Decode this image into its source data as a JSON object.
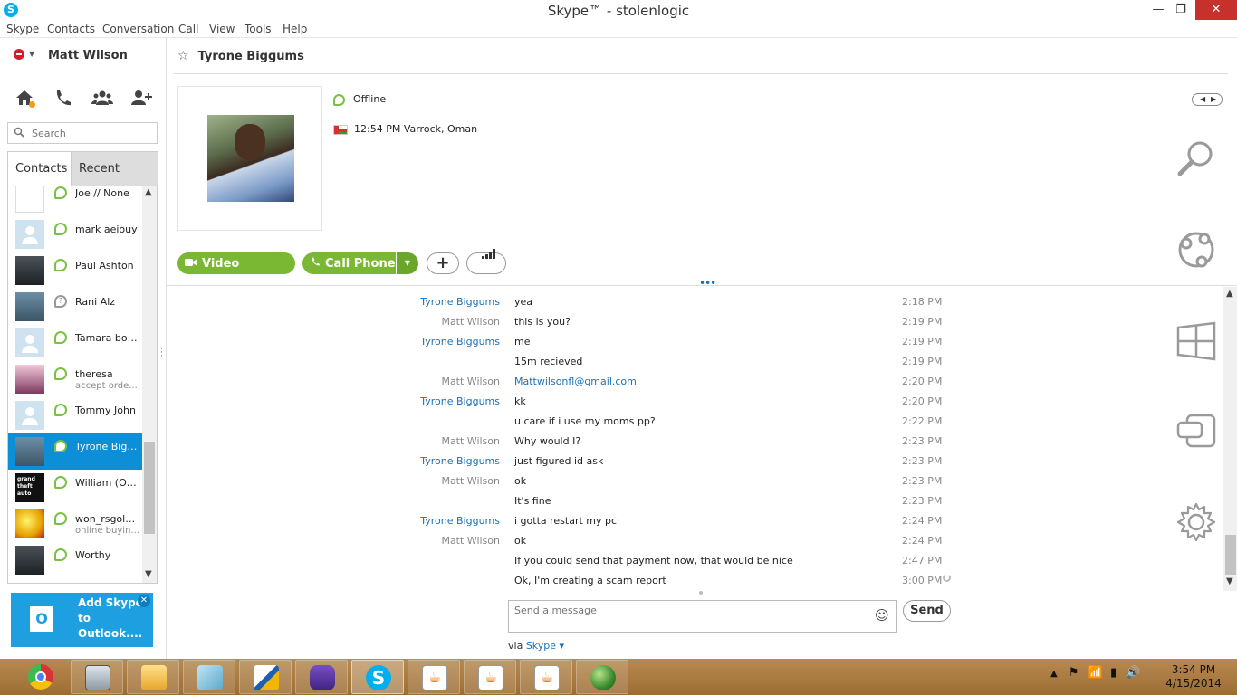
{
  "window": {
    "title": "Skype™ - stolenlogic",
    "minimize": "—",
    "restore": "❐",
    "close": "✕"
  },
  "menu": [
    "Skype",
    "Contacts",
    "Conversation",
    "Call",
    "View",
    "Tools",
    "Help"
  ],
  "user": {
    "name": "Matt Wilson",
    "status_color": "#d61c2a"
  },
  "search": {
    "placeholder": "Search"
  },
  "tabs": {
    "contacts": "Contacts",
    "recent": "Recent"
  },
  "contacts": [
    {
      "name": "Joe // None",
      "mood": ""
    },
    {
      "name": "mark aeiouy",
      "mood": ""
    },
    {
      "name": "Paul Ashton",
      "mood": ""
    },
    {
      "name": "Rani Alz",
      "mood": ""
    },
    {
      "name": "Tamara bou...",
      "mood": ""
    },
    {
      "name": "theresa",
      "mood": "accept orde..."
    },
    {
      "name": "Tommy John",
      "mood": ""
    },
    {
      "name": "Tyrone Bigg...",
      "mood": ""
    },
    {
      "name": "William (Ony...",
      "mood": ""
    },
    {
      "name": "won_rsgold...",
      "mood": "online buyin..."
    },
    {
      "name": "Worthy",
      "mood": ""
    }
  ],
  "avatar_text": {
    "gta": "grand theft auto"
  },
  "outlook_promo": {
    "text": "Add Skype to Outlook....",
    "icon": "O"
  },
  "conversation": {
    "contact_name": "Tyrone Biggums",
    "status": "Offline",
    "local_time": "12:54 PM Varrock, Oman",
    "buttons": {
      "video_message": "Video Message",
      "call_phone": "Call Phone",
      "add": "+"
    }
  },
  "messages": [
    {
      "from": "Tyrone Biggums",
      "text": "yea",
      "time": "2:18 PM",
      "them": true
    },
    {
      "from": "Matt Wilson",
      "text": "this is you?",
      "time": "2:19 PM",
      "them": false
    },
    {
      "from": "Tyrone Biggums",
      "text": "me",
      "time": "2:19 PM",
      "them": true
    },
    {
      "from": "",
      "text": "15m recieved",
      "time": "2:19 PM",
      "them": true
    },
    {
      "from": "Matt Wilson",
      "text": "Mattwilsonfl@gmail.com",
      "time": "2:20 PM",
      "them": false,
      "link": true
    },
    {
      "from": "Tyrone Biggums",
      "text": "kk",
      "time": "2:20 PM",
      "them": true
    },
    {
      "from": "",
      "text": "u care if i use my moms pp?",
      "time": "2:22 PM",
      "them": true
    },
    {
      "from": "Matt Wilson",
      "text": "Why would I?",
      "time": "2:23 PM",
      "them": false
    },
    {
      "from": "Tyrone Biggums",
      "text": "just figured id ask",
      "time": "2:23 PM",
      "them": true
    },
    {
      "from": "Matt Wilson",
      "text": "ok",
      "time": "2:23 PM",
      "them": false
    },
    {
      "from": "",
      "text": "It's fine",
      "time": "2:23 PM",
      "them": false
    },
    {
      "from": "Tyrone Biggums",
      "text": " i gotta restart my pc",
      "time": "2:24 PM",
      "them": true
    },
    {
      "from": "Matt Wilson",
      "text": "ok",
      "time": "2:24 PM",
      "them": false
    },
    {
      "from": "",
      "text": "If you could send that payment now, that would be nice",
      "time": "2:47 PM",
      "them": false
    },
    {
      "from": "",
      "text": "Ok, I'm creating a scam report",
      "time": "3:00 PM",
      "them": false,
      "pending": true
    }
  ],
  "compose": {
    "placeholder": "Send a message",
    "send": "Send",
    "via_label": "via",
    "via_value": "Skype"
  },
  "taskbar": {
    "apps": [
      "chrome-icon",
      "calculator-icon",
      "file-explorer-icon",
      "notepad-icon",
      "paint-icon",
      "gameboy-emulator-icon",
      "skype-icon",
      "java-icon",
      "java-icon",
      "java-icon",
      "globe-icon"
    ],
    "clock_time": "3:54 PM",
    "clock_date": "4/15/2014"
  },
  "colors": {
    "skype_blue": "#00aff0",
    "action_green": "#7ab834",
    "link_blue": "#1a72b8",
    "selected": "#0c8fd6",
    "taskbar": "#b08048"
  }
}
